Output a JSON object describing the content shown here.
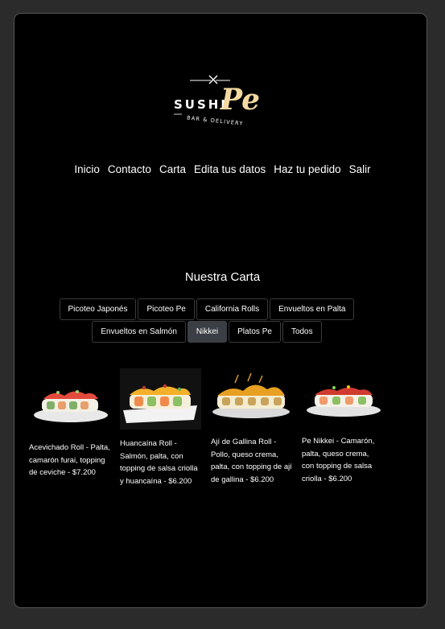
{
  "brand": {
    "logo_sushi": "SUSHI",
    "logo_pe": "Pe",
    "logo_tagline": "BAR & DELIVERY",
    "accent": "#f4d9a1"
  },
  "nav": {
    "items": [
      {
        "label": "Inicio"
      },
      {
        "label": "Contacto"
      },
      {
        "label": "Carta"
      },
      {
        "label": "Edita tus datos"
      },
      {
        "label": "Haz tu pedido"
      },
      {
        "label": "Salir"
      }
    ]
  },
  "menu": {
    "title": "Nuestra Carta",
    "filters": [
      {
        "label": "Picoteo Japonés",
        "active": false
      },
      {
        "label": "Picoteo Pe",
        "active": false
      },
      {
        "label": "California Rolls",
        "active": false
      },
      {
        "label": "Envueltos en Palta",
        "active": false
      },
      {
        "label": "Envueltos en Salmón",
        "active": false
      },
      {
        "label": "Nikkei",
        "active": true
      },
      {
        "label": "Platos Pe",
        "active": false
      },
      {
        "label": "Todos",
        "active": false
      }
    ],
    "products": [
      {
        "text": "Acevichado Roll - Palta, camarón furai, topping de ceviche - $7.200"
      },
      {
        "text": "Huancaína Roll - Salmón, palta, con topping de salsa criolla y huancaína - $6.200"
      },
      {
        "text": "Ají de Gallina Roll - Pollo, queso crema, palta, con topping de ají de gallina - $6.200"
      },
      {
        "text": "Pe Nikkei - Camarón, palta, queso crema, con topping de salsa criolla - $6.200"
      }
    ]
  }
}
